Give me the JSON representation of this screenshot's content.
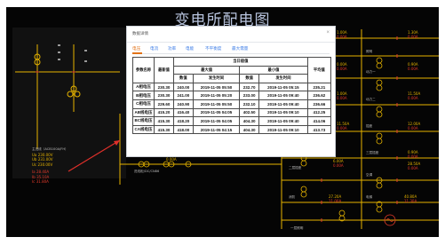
{
  "page": {
    "title": "变电所配电图"
  },
  "left_block": {
    "name": "主进线（ACB100A/FH）",
    "rows": [
      {
        "k": "Ua",
        "v": "230.00V"
      },
      {
        "k": "Ub",
        "v": "231.00V"
      },
      {
        "k": "Uc",
        "v": "230.00V"
      },
      {
        "k": "Ia",
        "v": "28.40A"
      },
      {
        "k": "Ib",
        "v": "35.10A"
      },
      {
        "k": "Ic",
        "v": "31.80A"
      }
    ],
    "cabinet": "进线柜/DC/CN86",
    "cabinet_value": "0.00A"
  },
  "right_readings": [
    {
      "a": "1.00A",
      "b": "0.00A"
    },
    {
      "a": "1.30A",
      "b": "0.00A"
    },
    {
      "a": "0.00A",
      "b": "0.00A"
    },
    {
      "a": "0.90A",
      "b": "0.00A"
    },
    {
      "a": "1.00A",
      "b": "0.00A"
    },
    {
      "a": "11.50A",
      "b": "0.00A"
    },
    {
      "a": "11.50A",
      "b": "0.00A"
    },
    {
      "a": "12.00A",
      "b": "0.00A"
    },
    {
      "a": "40.60A",
      "b": "40.00A"
    },
    {
      "a": "0.90A",
      "b": "0.00A"
    },
    {
      "a": "6.00A",
      "b": "0.00A"
    },
    {
      "a": "28.50A",
      "b": "0.00A"
    },
    {
      "a": "27.20A",
      "b": "11.00A"
    },
    {
      "a": "40.80A",
      "b": "11.30A"
    }
  ],
  "feeder_labels": [
    "照明",
    "动力一",
    "动力二",
    "插座",
    "二层插座",
    "三层插座",
    "空调",
    "一层照明",
    "电梯",
    "消防"
  ],
  "dialog": {
    "title": "数据详情",
    "close": "×",
    "tabs": [
      "电压",
      "电流",
      "功率",
      "电能",
      "不平衡度",
      "最大需量"
    ],
    "active_tab": 0,
    "headers": {
      "param": "参数名称",
      "latest": "最新值",
      "group": "当日极值",
      "max": "最大值",
      "min": "最小值",
      "avg": "平均值",
      "value": "数值",
      "time": "发生时间"
    },
    "rows": [
      [
        "A相电压",
        "230.30",
        "240.00",
        "2019-11-05 05:50",
        "232.70",
        "2019-11-05 05:15",
        "235.21"
      ],
      [
        "B相电压",
        "230.30",
        "241.00",
        "2019-11-05 05:20",
        "233.00",
        "2019-11-05 09:40",
        "236.62"
      ],
      [
        "C相电压",
        "229.60",
        "240.90",
        "2019-11-05 05:50",
        "232.10",
        "2019-11-05 09:40",
        "236.66"
      ],
      [
        "AB线电压",
        "415.20",
        "416.40",
        "2019-11-05 04:05",
        "402.50",
        "2019-11-05 09:10",
        "412.25"
      ],
      [
        "BC线电压",
        "415.30",
        "418.20",
        "2019-11-05 04:05",
        "404.30",
        "2019-11-05 09:40",
        "414.06"
      ],
      [
        "CA线电压",
        "415.30",
        "418.00",
        "2019-11-05 04:15",
        "404.30",
        "2019-11-05 09:10",
        "413.73"
      ]
    ]
  }
}
